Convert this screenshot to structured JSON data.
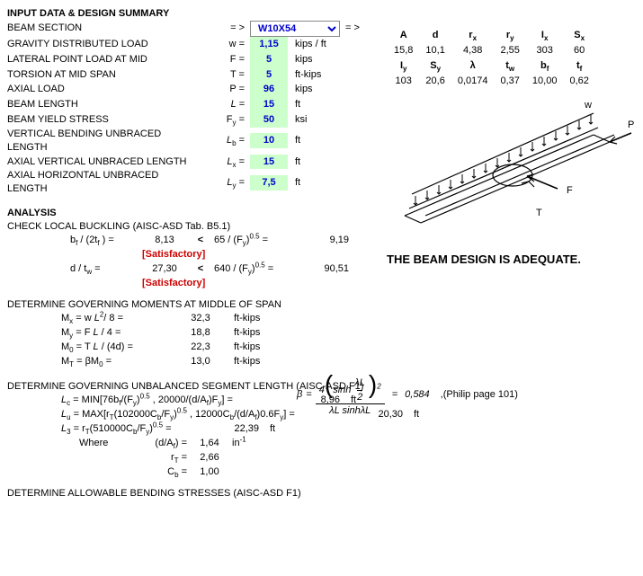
{
  "title": "INPUT DATA & DESIGN SUMMARY",
  "inputs": {
    "beam_section": {
      "label": "BEAM SECTION",
      "eq": "= >",
      "value": "W10X54",
      "arrow2": "= >"
    },
    "gravity_load": {
      "label": "GRAVITY DISTRIBUTED LOAD",
      "sym": "w =",
      "value": "1,15",
      "unit": "kips / ft"
    },
    "lateral_point": {
      "label": "LATERAL POINT LOAD AT MID",
      "sym": "F =",
      "value": "5",
      "unit": "kips"
    },
    "torsion": {
      "label": "TORSION AT MID SPAN",
      "sym": "T =",
      "value": "5",
      "unit": "ft-kips"
    },
    "axial_load": {
      "label": "AXIAL LOAD",
      "sym": "P =",
      "value": "96",
      "unit": "kips"
    },
    "beam_length": {
      "label": "BEAM LENGTH",
      "sym": "L =",
      "symital": true,
      "value": "15",
      "unit": "ft"
    },
    "yield_stress": {
      "label": "BEAM YIELD STRESS",
      "sym": "F",
      "sub": "y",
      "post": " =",
      "value": "50",
      "unit": "ksi"
    },
    "vert_unbraced": {
      "label": "VERTICAL BENDING UNBRACED LENGTH",
      "sym": "L",
      "sub": "b",
      "ital": true,
      "post": " =",
      "value": "10",
      "unit": "ft"
    },
    "ax_vert_unbraced": {
      "label": "AXIAL VERTICAL UNBRACED LENGTH",
      "sym": "L",
      "sub": "x",
      "ital": true,
      "post": " =",
      "value": "15",
      "unit": "ft"
    },
    "ax_horiz_unbraced": {
      "label": "AXIAL HORIZONTAL UNBRACED LENGTH",
      "sym": "L",
      "sub": "y",
      "ital": true,
      "post": " =",
      "value": "7,5",
      "unit": "ft"
    }
  },
  "props": {
    "h1": [
      "A",
      "d",
      "rₓ",
      "rᵧ",
      "Iₓ",
      "Sₓ"
    ],
    "r1": [
      "15,8",
      "10,1",
      "4,38",
      "2,55",
      "303",
      "60"
    ],
    "h2": [
      "Iᵧ",
      "Sᵧ",
      "λ",
      "t_w",
      "b_f",
      "t_f"
    ],
    "r2": [
      "103",
      "20,6",
      "0,0174",
      "0,37",
      "10,00",
      "0,62"
    ]
  },
  "analysis": {
    "title": "ANALYSIS",
    "local_buckling": {
      "heading": "CHECK LOCAL BUCKLING (AISC-ASD Tab. B5.1)",
      "line1": {
        "lhs": "b_f / (2t_f)  =",
        "val": "8,13",
        "cmp": "<",
        "rhs": "65 / (F_y)^0.5 =",
        "res": "9,19"
      },
      "sat1": "[Satisfactory]",
      "line2": {
        "lhs": "d / t_w =",
        "val": "27,30",
        "cmp": "<",
        "rhs": "640 / (F_y)^0.5 =",
        "res": "90,51"
      },
      "sat2": "[Satisfactory]"
    },
    "moments": {
      "heading": "DETERMINE GOVERNING MOMENTS AT MIDDLE OF SPAN",
      "rows": [
        {
          "lhs_html": "M<sub>x</sub> = w <i>L</i><sup>2</sup>/ 8  =",
          "val": "32,3",
          "unit": "ft-kips"
        },
        {
          "lhs_html": "M<sub>y</sub> = F <i>L</i>   / 4  =",
          "val": "18,8",
          "unit": "ft-kips"
        },
        {
          "lhs_html": "M<sub>0</sub> = T <i>L</i>   / (4d)  =",
          "val": "22,3",
          "unit": "ft-kips"
        },
        {
          "lhs_html": "M<sub>T</sub> = βM<sub>0</sub> =",
          "val": "13,0",
          "unit": "ft-kips"
        }
      ],
      "beta": {
        "eq": "β =",
        "val": "0,584",
        "note": ",(Philip page 101)"
      }
    },
    "unbalanced": {
      "heading": "DETERMINE GOVERNING UNBALANCED SEGMENT LENGTH (AISC-ASD F1)",
      "l_c": {
        "lhs_html": "<i>L</i><sub>c</sub> = MIN[76b<sub>f</sub>/(F<sub>y</sub>)<sup>0.5</sup> , 20000/(d/A<sub>f</sub>)F<sub>y</sub>] =",
        "val": "8,96",
        "unit": "ft"
      },
      "l_u": {
        "lhs_html": "<i>L</i><sub>u</sub> = MAX[r<sub>T</sub>(102000C<sub>b</sub>/F<sub>y</sub>)<sup>0.5</sup> , 12000C<sub>b</sub>/(d/A<sub>f</sub>)0.6F<sub>y</sub>] =",
        "val": "20,30",
        "unit": "ft"
      },
      "l_3": {
        "lhs_html": "<i>L</i><sub>3</sub> = r<sub>T</sub>(510000C<sub>b</sub>/F<sub>y</sub>)<sup>0.5</sup>  =",
        "val": "22,39",
        "unit": "ft"
      },
      "where": "Where",
      "d_af": {
        "label": "(d/A_f)  =",
        "val": "1,64",
        "unit": "in⁻¹"
      },
      "rT": {
        "label": "r_T  =",
        "val": "2,66"
      },
      "cb": {
        "label": "C_b  =",
        "val": "1,00"
      }
    },
    "allowable": {
      "heading": "DETERMINE ALLOWABLE BENDING STRESSES (AISC-ASD F1)"
    }
  },
  "adequate": "THE BEAM DESIGN IS ADEQUATE.",
  "diagram_labels": {
    "w": "w",
    "P": "P",
    "F": "F",
    "T": "T"
  }
}
